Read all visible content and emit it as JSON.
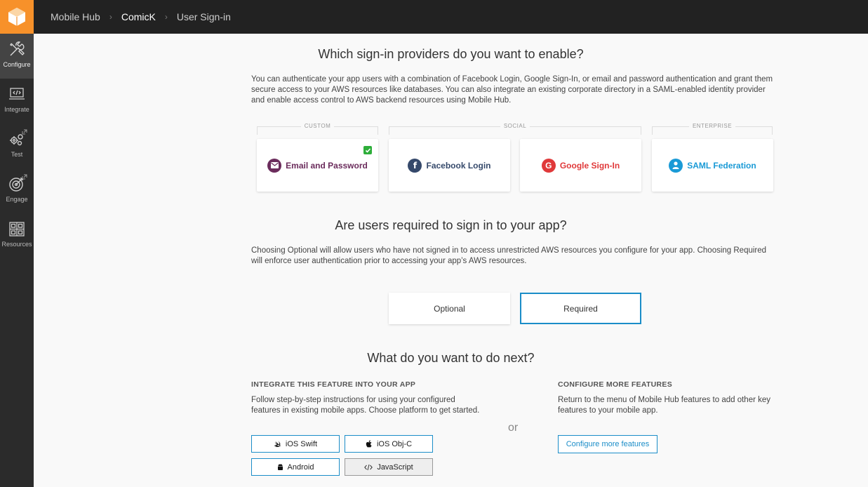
{
  "breadcrumb": [
    "Mobile Hub",
    "ComicK",
    "User Sign-in"
  ],
  "sidebar": [
    {
      "label": "Configure",
      "icon": "tools-icon",
      "active": true
    },
    {
      "label": "Integrate",
      "icon": "code-laptop-icon"
    },
    {
      "label": "Test",
      "icon": "gears-icon"
    },
    {
      "label": "Engage",
      "icon": "target-icon"
    },
    {
      "label": "Resources",
      "icon": "grid-icon"
    }
  ],
  "providers": {
    "title": "Which sign-in providers do you want to enable?",
    "description": "You can authenticate your app users with a combination of Facebook Login, Google Sign-In, or email and password authentication and grant them secure access to your AWS resources like databases. You can also integrate an existing corporate directory in a SAML-enabled identity provider and enable access control to AWS backend resources using Mobile Hub.",
    "groups": [
      "CUSTOM",
      "SOCIAL",
      "ENTERPRISE"
    ],
    "cards": [
      {
        "label": "Email and Password",
        "color": "#6b2c5c",
        "checked": true
      },
      {
        "label": "Facebook Login",
        "color": "#35496b"
      },
      {
        "label": "Google Sign-In",
        "color": "#e0393a"
      },
      {
        "label": "SAML Federation",
        "color": "#1a9ad6"
      }
    ]
  },
  "required": {
    "title": "Are users required to sign in to your app?",
    "description": "Choosing Optional will allow users who have not signed in to access unrestricted AWS resources you configure for your app. Choosing Required will enforce user authentication prior to accessing your app’s AWS resources.",
    "options": [
      "Optional",
      "Required"
    ],
    "selected": "Required"
  },
  "next": {
    "title": "What do you want to do next?",
    "integrate_heading": "INTEGRATE THIS FEATURE INTO YOUR APP",
    "integrate_text": "Follow step-by-step instructions for using your configured features in existing mobile apps. Choose platform to get started.",
    "or": "or",
    "platforms": [
      "iOS Swift",
      "iOS Obj-C",
      "Android",
      "JavaScript"
    ],
    "configure_heading": "CONFIGURE MORE FEATURES",
    "configure_text": "Return to the menu of Mobile Hub features to add other key features to your mobile app.",
    "configure_button": "Configure more features"
  }
}
